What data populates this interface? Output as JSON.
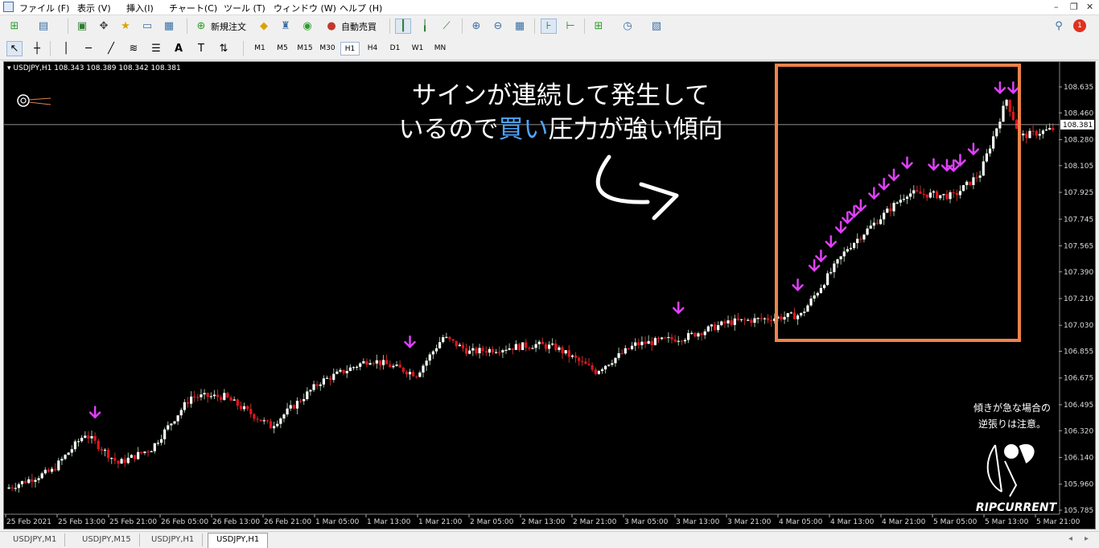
{
  "menu": {
    "items": [
      "ファイル (F)",
      "表示 (V)",
      "挿入(I)",
      "チャート(C)",
      "ツール (T)",
      "ウィンドウ (W)",
      "ヘルプ (H)"
    ],
    "window_controls": [
      "–",
      "❐",
      "✕"
    ]
  },
  "toolbar": {
    "new_order_label": "新規注文",
    "auto_trade_label": "自動売買",
    "timeframes": [
      "M1",
      "M5",
      "M15",
      "M30",
      "H1",
      "H4",
      "D1",
      "W1",
      "MN"
    ],
    "active_timeframe": "H1",
    "notification_count": "1"
  },
  "chart": {
    "header": "USDJPY,H1  108.343 108.389 108.342 108.381",
    "current_price": "108.381",
    "price_levels": [
      "108.635",
      "108.460",
      "108.280",
      "108.105",
      "107.925",
      "107.745",
      "107.565",
      "107.390",
      "107.210",
      "107.030",
      "106.855",
      "106.675",
      "106.495",
      "106.320",
      "106.140",
      "105.960",
      "105.785"
    ],
    "time_labels": [
      "25 Feb 2021",
      "25 Feb 13:00",
      "25 Feb 21:00",
      "26 Feb 05:00",
      "26 Feb 13:00",
      "26 Feb 21:00",
      "1 Mar 05:00",
      "1 Mar 13:00",
      "1 Mar 21:00",
      "2 Mar 05:00",
      "2 Mar 13:00",
      "2 Mar 21:00",
      "3 Mar 05:00",
      "3 Mar 13:00",
      "3 Mar 21:00",
      "4 Mar 05:00",
      "4 Mar 13:00",
      "4 Mar 21:00",
      "5 Mar 05:00",
      "5 Mar 13:00",
      "5 Mar 21:00"
    ],
    "colors": {
      "bull": "#ffffff",
      "bear": "#e0141c",
      "signal": "#e040fb",
      "highlight": "#f0824a",
      "bid_line": "#c0c0c0"
    },
    "annotation_line1": "サインが連続して発生して",
    "annotation_line2_a": "いるので",
    "annotation_line2_b": "買い",
    "annotation_line2_c": "圧力が強い傾向",
    "annotation_highlight_color": "#4da6ff",
    "note_line1": "傾きが急な場合の",
    "note_line2": "逆張りは注意。",
    "logo_text": "RIPCURRENT"
  },
  "tabs": [
    "USDJPY,M1",
    "USDJPY,M15",
    "USDJPY,H1",
    "USDJPY,H1"
  ],
  "active_tab_index": 3
}
